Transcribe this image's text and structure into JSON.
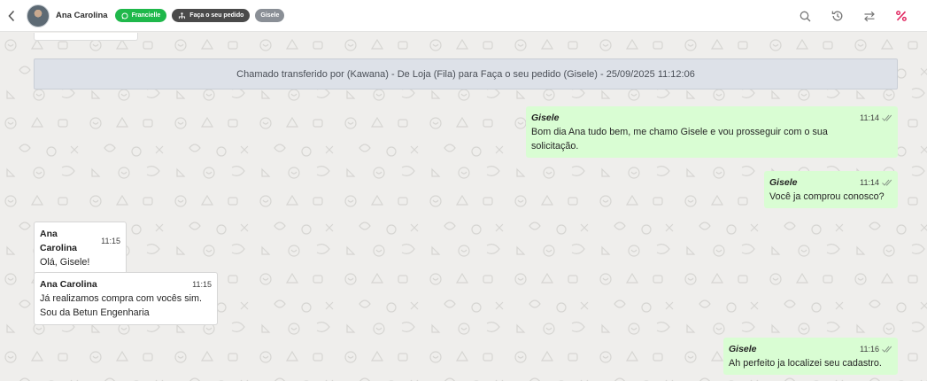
{
  "header": {
    "contact_name": "Ana Carolina",
    "chips": {
      "whatsapp": "Francielle",
      "queue": "Faça o seu pedido",
      "agent": "Gisele"
    },
    "icons": [
      "back-arrow-icon",
      "whatsapp-icon",
      "queue-icon",
      "search-icon",
      "history-icon",
      "transfer-icon",
      "percent-icon"
    ]
  },
  "chat": {
    "system_banner": "Chamado transferido por (Kawana) - De Loja (Fila) para Faça o seu pedido (Gisele) - 25/09/2025 11:12:06",
    "messages": [
      {
        "author": "Gisele",
        "time": "11:14",
        "lines": [
          "Bom dia Ana tudo bem, me chamo Gisele e vou prosseguir com o sua",
          "solicitação."
        ]
      },
      {
        "author": "Gisele",
        "time": "11:14",
        "lines": [
          "Você ja comprou conosco?"
        ]
      },
      {
        "author": "Ana Carolina",
        "time": "11:15",
        "lines": [
          "Olá, Gisele!"
        ]
      },
      {
        "author": "Ana Carolina",
        "time": "11:15",
        "lines": [
          "Já realizamos compra com vocês sim.",
          "Sou da Betun Engenharia"
        ]
      },
      {
        "author": "Gisele",
        "time": "11:16",
        "lines": [
          "Ah perfeito ja localizei seu cadastro."
        ]
      }
    ]
  },
  "colors": {
    "outgoing_bubble": "#d9fdd3",
    "incoming_bubble": "#ffffff",
    "whatsapp_chip": "#1fb84b",
    "queue_chip": "#4a4a4a",
    "agent_chip": "#8a8f96",
    "system_banner": "#dde1e8",
    "percent_icon": "#e0245e"
  }
}
